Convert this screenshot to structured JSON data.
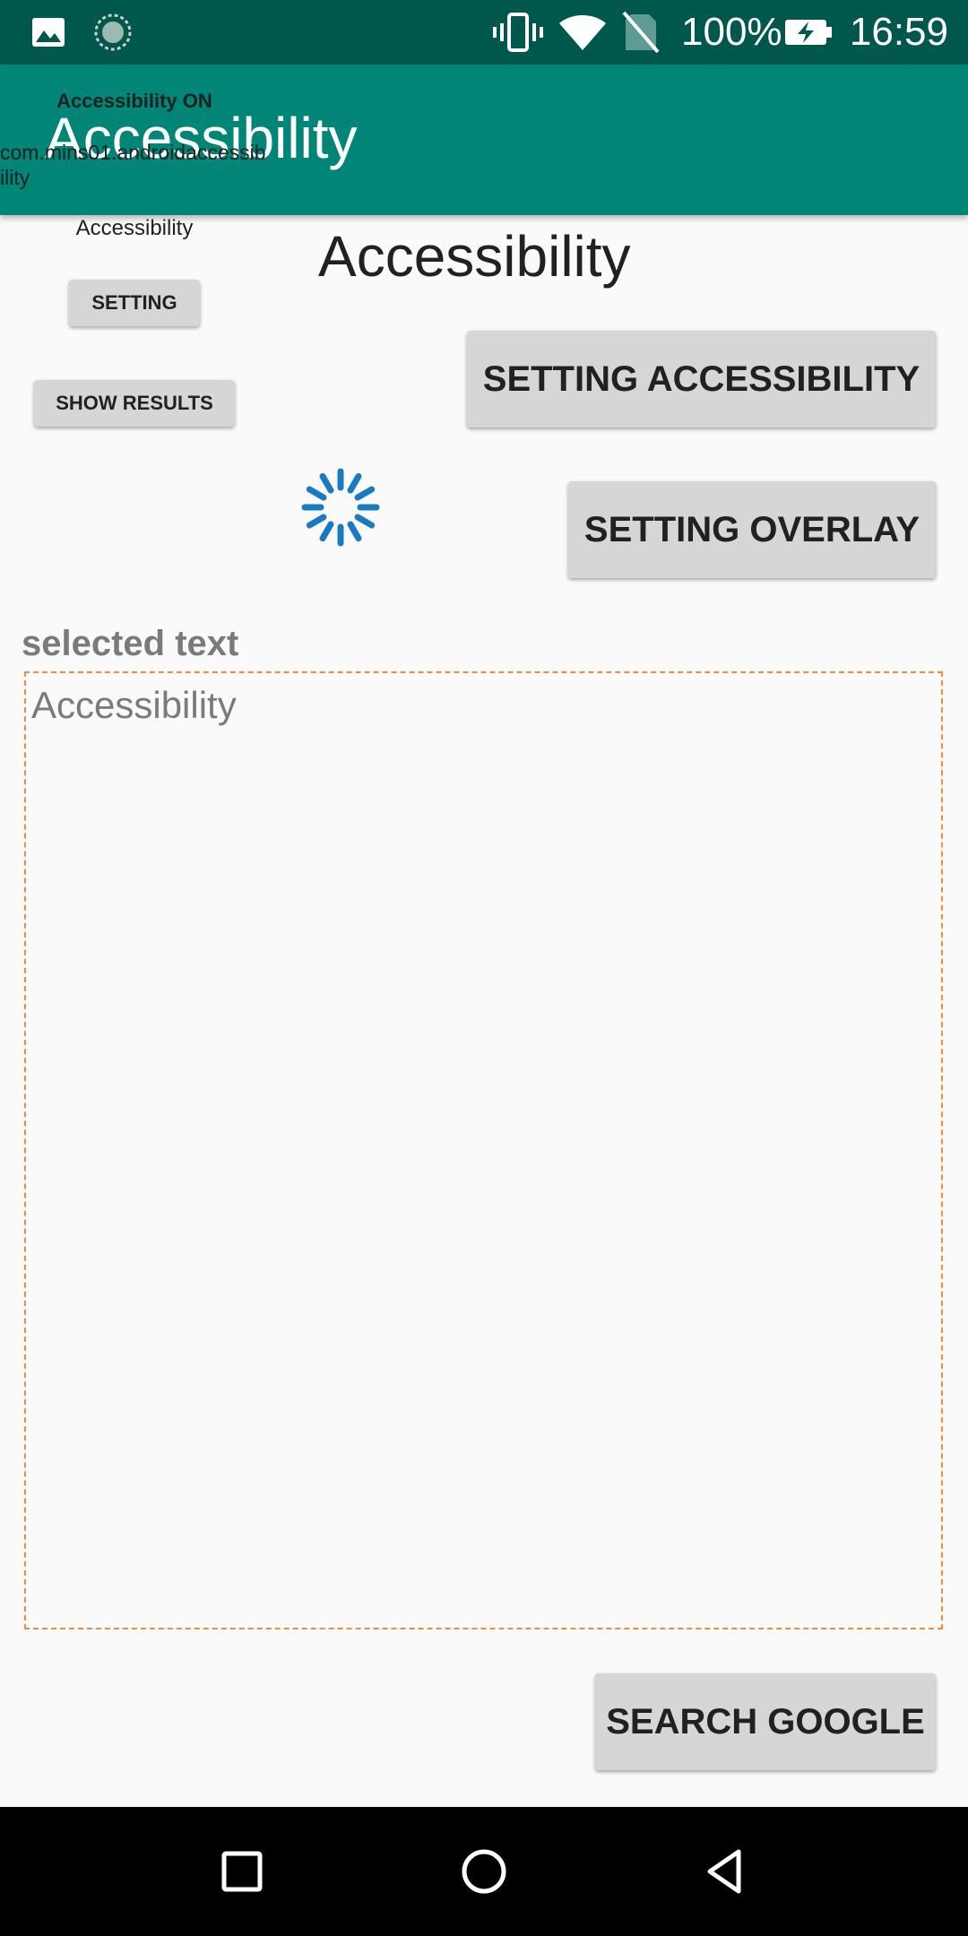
{
  "status_bar": {
    "battery_text": "100%",
    "time": "16:59",
    "icons": [
      "image-icon",
      "sync-icon",
      "vibrate-icon",
      "wifi-icon",
      "no-sim-icon",
      "battery-charging-icon"
    ]
  },
  "app_bar": {
    "title": "Accessibility"
  },
  "overlay": {
    "status": "Accessibility ON",
    "package": "com.mins01.androidaccessibility",
    "class_text": "Accessibility",
    "setting_label": "SETTING",
    "show_results_label": "SHOW RESULTS"
  },
  "main": {
    "heading": "Accessibility",
    "setting_accessibility_label": "SETTING ACCESSIBILITY",
    "setting_overlay_label": "SETTING OVERLAY",
    "selected_label": "selected text",
    "selected_text": "Accessibility",
    "search_google_label": "SEARCH GOOGLE"
  },
  "nav_bar": {
    "icons": [
      "recents-icon",
      "home-icon",
      "back-icon"
    ]
  },
  "colors": {
    "status_bar": "#00574B",
    "app_bar": "#008577",
    "background": "#FAFAFA",
    "button": "#D6D6D6",
    "spinner": "#1A7ABF",
    "dashed_border": "#F28C3C"
  }
}
